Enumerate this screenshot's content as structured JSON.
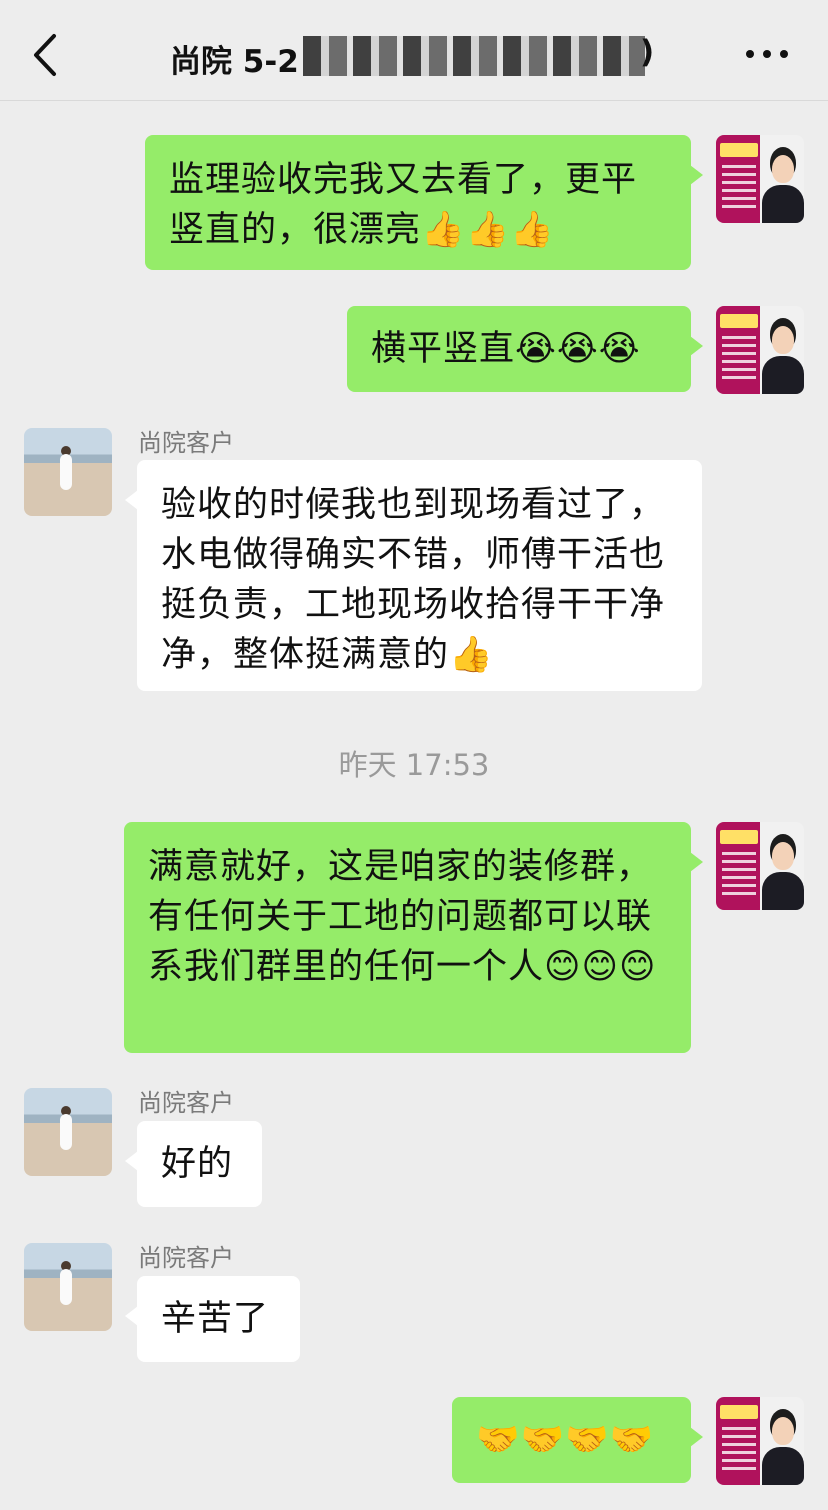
{
  "header": {
    "title": "尚院 5-2",
    "title_tail": ")",
    "back_icon": "chevron-left-icon",
    "more_icon": "more-dots-icon"
  },
  "messages": [
    {
      "from": "self",
      "text": "监理验收完我又去看了，更平竖直的，很漂亮👍👍👍"
    },
    {
      "from": "self",
      "text": "横平竖直😭😭😭"
    },
    {
      "from": "other",
      "sender": "尚院客户",
      "text": "验收的时候我也到现场看过了，水电做得确实不错，师傅干活也挺负责，工地现场收拾得干干净净，整体挺满意的👍"
    },
    {
      "from": "self",
      "text": "满意就好，这是咱家的装修群，有任何关于工地的问题都可以联系我们群里的任何一个人😊😊😊"
    },
    {
      "from": "other",
      "sender": "尚院客户",
      "text": "好的"
    },
    {
      "from": "other",
      "sender": "尚院客户",
      "text": "辛苦了"
    },
    {
      "from": "self",
      "text": "🤝🤝🤝🤝"
    }
  ],
  "timestamp": "昨天 17:53",
  "colors": {
    "self_bubble": "#95ec69",
    "other_bubble": "#ffffff",
    "background": "#ededed"
  }
}
